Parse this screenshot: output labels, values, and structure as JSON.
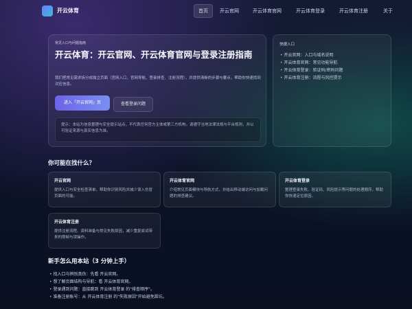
{
  "header": {
    "brand": "开云体育",
    "nav": [
      {
        "label": "首页",
        "active": true
      },
      {
        "label": "开云官网",
        "active": false
      },
      {
        "label": "开云体育官网",
        "active": false
      },
      {
        "label": "开云体育登录",
        "active": false
      },
      {
        "label": "开云体育注册",
        "active": false
      },
      {
        "label": "关于",
        "active": false
      }
    ]
  },
  "hero": {
    "tag": "常见入口与问题指南",
    "title": "开云体育：开云官网、开云体育官网与登录注册指南",
    "description": "我们把常见需求拆分成独立页面（官网入口、官网导航、登录排查、注册流程），并提供清晰的步骤与要点，帮助你快速找到对应信息。",
    "primary_button": "进入「开云官网」页",
    "secondary_button": "查看登录问题",
    "notice": "提示：本站为信息整理与安全提示站点，不代表任何官方主体或第三方机构。请遵守当地法律法规与平台规则，并以可验证来源与真实信息为准。"
  },
  "quick": {
    "title": "快捷入口",
    "items": [
      "开云官网：入口与域名说明",
      "开云体育官网：常见功能导航",
      "开云体育登录：验证码/密码问题",
      "开云体育注册：流程与风控提示"
    ]
  },
  "section1": {
    "title": "你可能在找什么？",
    "cards": [
      {
        "title": "开云官网",
        "desc": "提供入口与安全检查清单，帮助你识别风险并减少误入仿冒页面的可能。"
      },
      {
        "title": "开云体育官网",
        "desc": "介绍常见页面模块与导航方式，并给出移动端访问与加载问题的排查建议。"
      },
      {
        "title": "开云体育登录",
        "desc": "整理登录失败、验证码、风险提示等问题的处理顺序，帮助你快速定位原因。"
      },
      {
        "title": "开云体育注册",
        "desc": "提供注册流程、资料准备与常见失败原因，减少重复尝试带来的限制与误操作。"
      }
    ]
  },
  "section2": {
    "title": "新手怎么用本站（3 分钟上手）",
    "steps": [
      "找入口与辨别真伪：先看 开云官网。",
      "想了解页面结构与导航：看 开云体育官网。",
      "登录遇到问题：直接跳到 开云体育登录 的\"排查顺序\"。",
      "准备注册账号：从 开云体育注册 的\"失败原因\"开始避免踩坑。"
    ]
  }
}
